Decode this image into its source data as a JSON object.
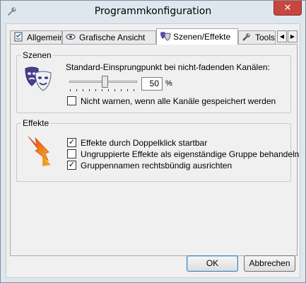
{
  "window": {
    "title": "Programmkonfiguration",
    "close_label": "✕"
  },
  "tabs": [
    {
      "label": "Allgemein",
      "icon": "checklist-icon",
      "active": false
    },
    {
      "label": "Grafische Ansicht",
      "icon": "eye-icon",
      "active": false
    },
    {
      "label": "Szenen/Effekte",
      "icon": "masks-icon",
      "active": true
    },
    {
      "label": "Tools",
      "icon": "tools-icon",
      "active": false
    }
  ],
  "tab_scroll": {
    "left": "◀",
    "right": "▶"
  },
  "szenen": {
    "group_label": "Szenen",
    "icon": "theater-masks-icon",
    "slider_label": "Standard-Einsprungpunkt bei nicht-fadenden Kanälen:",
    "slider_value": 50,
    "slider_value_text": "50",
    "slider_unit": "%",
    "no_warn_checkbox": {
      "label": "Nicht warnen, wenn alle Kanäle gespeichert werden",
      "checked": false
    }
  },
  "effekte": {
    "group_label": "Effekte",
    "icon": "lightning-bolt-icon",
    "options": [
      {
        "label": "Effekte durch Doppelklick startbar",
        "checked": true
      },
      {
        "label": "Ungruppierte Effekte als eigenständige Gruppe behandeln",
        "checked": false
      },
      {
        "label": "Gruppennamen rechtsbündig ausrichten",
        "checked": true
      }
    ]
  },
  "buttons": {
    "ok": "OK",
    "cancel": "Abbrechen"
  },
  "colors": {
    "close_button": "#c7463f",
    "bolt": "#f28a1e",
    "mask_blue": "#4a3f8f"
  }
}
